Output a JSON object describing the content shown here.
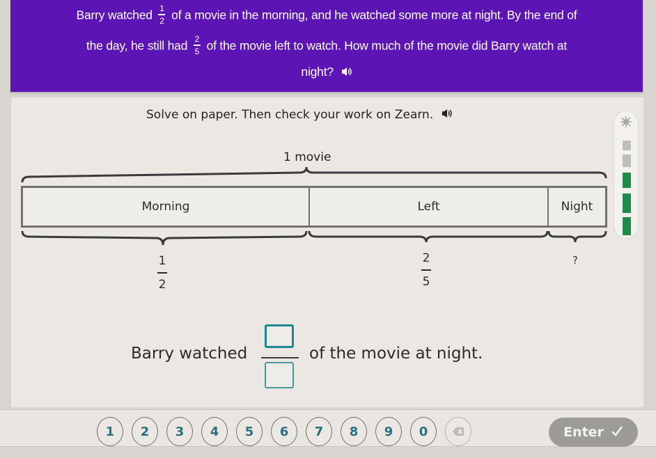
{
  "problem": {
    "line1_pre": "Barry watched",
    "line1_frac": {
      "num": "1",
      "den": "2"
    },
    "line1_post": "of a movie in the morning, and he watched some more at night. By the end of",
    "line2_pre": "the day, he still had",
    "line2_frac": {
      "num": "2",
      "den": "5"
    },
    "line2_post": "of the movie left to watch. How much of the movie did Barry watch at",
    "line3": "night?",
    "audio_icon": "speaker-icon"
  },
  "instruction": "Solve on paper. Then check your work on Zearn.",
  "progress_meter": {
    "icon": "sparkle-icon",
    "filled_segments": 3,
    "total_segments": 5,
    "fill_color": "#1f8a4c",
    "empty_color": "#bdbdbd"
  },
  "tape_diagram": {
    "total_label": "1 movie",
    "segments": [
      {
        "label": "Morning",
        "value": {
          "num": "1",
          "den": "2"
        }
      },
      {
        "label": "Left",
        "value": {
          "num": "2",
          "den": "5"
        }
      },
      {
        "label": "Night",
        "value_text": "?"
      }
    ]
  },
  "answer": {
    "pre": "Barry watched",
    "post": "of the movie at night.",
    "numerator": "",
    "denominator": ""
  },
  "keypad": {
    "keys": [
      "1",
      "2",
      "3",
      "4",
      "5",
      "6",
      "7",
      "8",
      "9",
      "0"
    ],
    "backspace_icon": "backspace-icon",
    "enter_label": "Enter",
    "enter_icon": "checkmark-icon"
  },
  "colors": {
    "header_bg": "#5d14b4",
    "key_text": "#2a6f82",
    "answer_box_border": "#1a8797"
  }
}
